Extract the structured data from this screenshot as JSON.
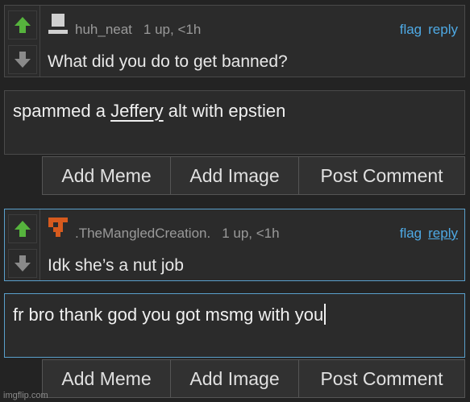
{
  "colors": {
    "background": "#232323",
    "panel": "#2b2b2b",
    "link": "#4ea9e4",
    "upvote_active": "#56b33d",
    "downvote": "#8a8a8a",
    "focus_border": "#5aa0cc"
  },
  "comments": [
    {
      "username": "huh_neat",
      "points": "1 up, <1h",
      "flag_label": "flag",
      "reply_label": "reply",
      "text": "What did you do to get banned?",
      "avatar_icon": "gray-block-avatar"
    },
    {
      "username": ".TheMangledCreation.",
      "points": "1 up, <1h",
      "flag_label": "flag",
      "reply_label": "reply",
      "text": "Idk she’s a nut job",
      "avatar_icon": "orange-pixel-avatar"
    }
  ],
  "replies": [
    {
      "prefix": "spammed a ",
      "underlined": "Jeffery",
      "suffix": " alt with epstien"
    },
    {
      "prefix": "fr bro thank god you got msmg with you",
      "underlined": "",
      "suffix": ""
    }
  ],
  "buttons": {
    "add_meme": "Add Meme",
    "add_image": "Add Image",
    "post_comment": "Post Comment"
  },
  "watermark": "imgflip.com"
}
